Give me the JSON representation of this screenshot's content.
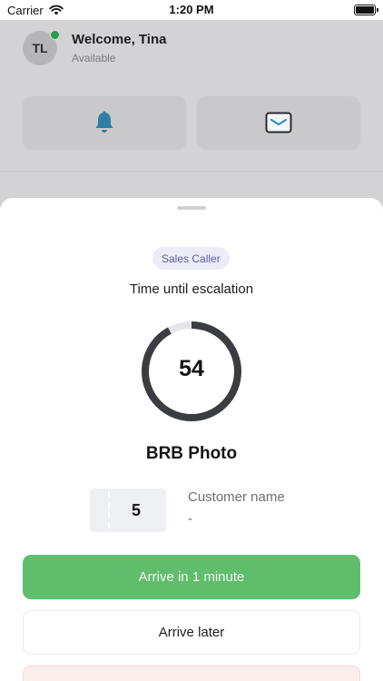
{
  "status_bar": {
    "carrier": "Carrier",
    "time": "1:20 PM",
    "icons": [
      "wifi-icon",
      "battery-icon"
    ]
  },
  "user": {
    "initials": "TL",
    "welcome": "Welcome, Tina",
    "status": "Available",
    "online": true
  },
  "quick_actions": [
    "bell-icon",
    "mail-icon"
  ],
  "sheet": {
    "role": "Sales Caller",
    "escalation_label": "Time until escalation",
    "countdown": "54",
    "countdown_progress": 0.92,
    "company": "BRB Photo",
    "ticket_number": "5",
    "customer_label": "Customer name",
    "customer_value": "-",
    "primary_action": "Arrive in 1 minute",
    "secondary_action": "Arrive later"
  },
  "colors": {
    "accent_green": "#5fbd6c",
    "badge_bg": "#ececf8",
    "badge_text": "#5e5ca6",
    "ring": "#3b3d42",
    "ring_track": "#e6e6ea",
    "online": "#2e9e4a"
  }
}
